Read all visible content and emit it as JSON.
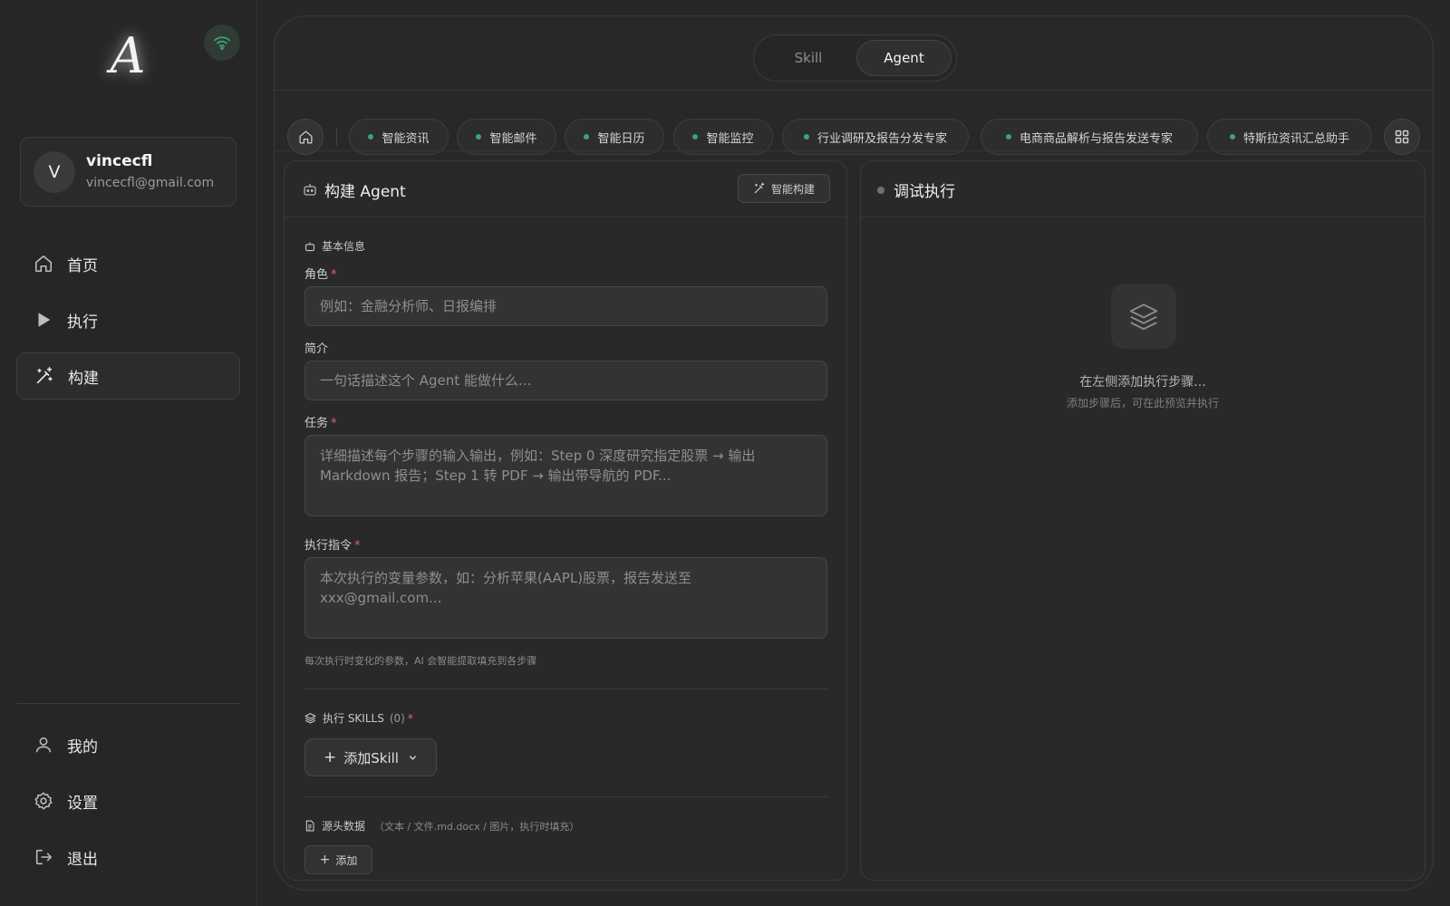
{
  "sidebar": {
    "logo_text": "A",
    "user": {
      "initial": "V",
      "name": "vincecfl",
      "email": "vincecfl@gmail.com"
    },
    "nav": [
      {
        "label": "首页",
        "icon": "home-icon"
      },
      {
        "label": "执行",
        "icon": "play-icon"
      },
      {
        "label": "构建",
        "icon": "magic-wand-icon",
        "active": true
      }
    ],
    "bottom_nav": [
      {
        "label": "我的",
        "icon": "user-icon"
      },
      {
        "label": "设置",
        "icon": "gear-icon"
      },
      {
        "label": "退出",
        "icon": "logout-icon"
      }
    ],
    "status_icon": "wifi-icon",
    "status_color": "#3fa07a"
  },
  "toggle": {
    "options": [
      "Skill",
      "Agent"
    ],
    "selected": "Agent"
  },
  "chips": [
    "智能资讯",
    "智能邮件",
    "智能日历",
    "智能监控",
    "行业调研及报告分发专家",
    "电商商品解析与报告发送专家",
    "特斯拉资讯汇总助手"
  ],
  "builder": {
    "title": "构建 Agent",
    "smart_button": "智能构建",
    "basic_info_label": "基本信息",
    "role": {
      "label": "角色",
      "required": "*",
      "placeholder": "例如：金融分析师、日报编排"
    },
    "intro": {
      "label": "简介",
      "placeholder": "一句话描述这个 Agent 能做什么..."
    },
    "task": {
      "label": "任务",
      "required": "*",
      "placeholder": "详细描述每个步骤的输入输出，例如：Step 0 深度研究指定股票 → 输出 Markdown 报告；Step 1 转 PDF → 输出带导航的 PDF..."
    },
    "command": {
      "label": "执行指令",
      "required": "*",
      "placeholder": "本次执行的变量参数，如：分析苹果(AAPL)股票，报告发送至 xxx@gmail.com...",
      "hint": "每次执行时变化的参数，AI 会智能提取填充到各步骤"
    },
    "skills": {
      "label": "执行 SKILLS",
      "count": "(0)",
      "required": "*",
      "add_button": "添加Skill"
    },
    "source": {
      "label": "源头数据",
      "note": "（文本 / 文件.md.docx / 图片，执行时填充）",
      "add_button": "添加"
    }
  },
  "debug": {
    "title": "调试执行",
    "empty_title": "在左侧添加执行步骤...",
    "empty_sub": "添加步骤后，可在此预览并执行"
  }
}
